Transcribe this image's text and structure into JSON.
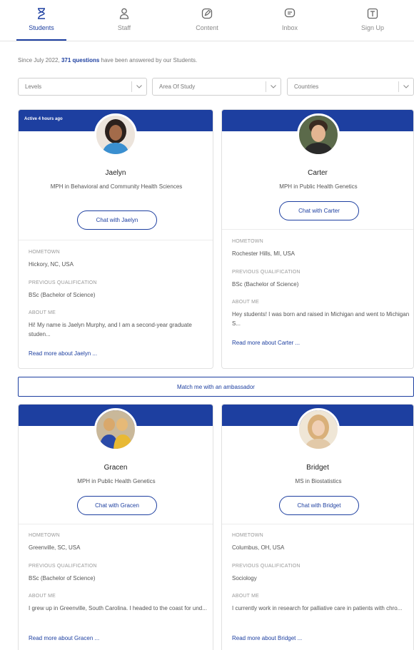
{
  "nav": {
    "tabs": [
      {
        "label": "Students",
        "icon": "hourglass-icon"
      },
      {
        "label": "Staff",
        "icon": "person-icon"
      },
      {
        "label": "Content",
        "icon": "edit-icon"
      },
      {
        "label": "Inbox",
        "icon": "chat-icon"
      },
      {
        "label": "Sign Up",
        "icon": "signup-icon"
      }
    ],
    "active_tab": "Students"
  },
  "intro": {
    "prefix": "Since July 2022, ",
    "highlight": "371 questions",
    "suffix": " have been answered by our Students."
  },
  "filters": [
    {
      "label": "Levels"
    },
    {
      "label": "Area Of Study"
    },
    {
      "label": "Countries"
    }
  ],
  "cards": [
    {
      "active_text": "Active 4 hours ago",
      "name": "Jaelyn",
      "program": "MPH in Behavioral and Community Health Sciences",
      "chat_label": "Chat with Jaelyn",
      "hometown_label": "HOMETOWN",
      "hometown": "Hickory, NC, USA",
      "qualification_label": "PREVIOUS QUALIFICATION",
      "qualification": "BSc (Bachelor of Science)",
      "about_label": "ABOUT ME",
      "about": "Hi! My name is Jaelyn Murphy, and I am a second-year graduate studen...",
      "read_more": "Read more about Jaelyn ..."
    },
    {
      "active_text": "",
      "name": "Carter",
      "program": "MPH in Public Health Genetics",
      "chat_label": "Chat with Carter",
      "hometown_label": "HOMETOWN",
      "hometown": "Rochester Hills, MI, USA",
      "qualification_label": "PREVIOUS QUALIFICATION",
      "qualification": "BSc (Bachelor of Science)",
      "about_label": "ABOUT ME",
      "about": "Hey students! I was born and raised in Michigan and went to Michigan S...",
      "read_more": "Read more about Carter ..."
    },
    {
      "active_text": "",
      "name": "Gracen",
      "program": "MPH in Public Health Genetics",
      "chat_label": "Chat with Gracen",
      "hometown_label": "HOMETOWN",
      "hometown": "Greenville, SC, USA",
      "qualification_label": "PREVIOUS QUALIFICATION",
      "qualification": "BSc (Bachelor of Science)",
      "about_label": "ABOUT ME",
      "about": "I grew up in Greenville, South Carolina. I headed to the coast for und...",
      "read_more": "Read more about Gracen ..."
    },
    {
      "active_text": "",
      "name": "Bridget",
      "program": "MS in Biostatistics",
      "chat_label": "Chat with Bridget",
      "hometown_label": "HOMETOWN",
      "hometown": "Columbus, OH, USA",
      "qualification_label": "PREVIOUS QUALIFICATION",
      "qualification": "Sociology",
      "about_label": "ABOUT ME",
      "about": "I currently work in research for palliative care in patients with chro...",
      "read_more": "Read more about Bridget ..."
    }
  ],
  "match_button": "Match me with an ambassador",
  "colors": {
    "accent": "#1d3fa0",
    "muted": "#8a8a8a"
  }
}
